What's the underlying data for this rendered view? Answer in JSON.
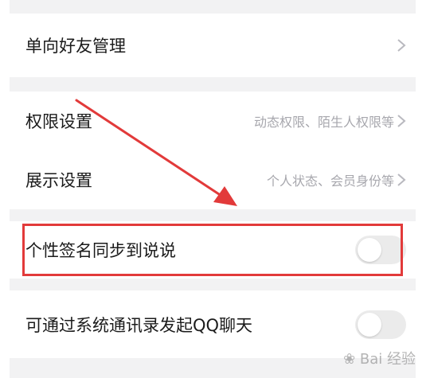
{
  "settings": {
    "one_way_friends": {
      "label": "单向好友管理"
    },
    "permissions": {
      "label": "权限设置",
      "value": "动态权限、陌生人权限等"
    },
    "display": {
      "label": "展示设置",
      "value": "个人状态、会员身份等"
    },
    "signature_sync": {
      "label": "个性签名同步到说说",
      "enabled": false
    },
    "contacts_chat": {
      "label": "可通过系统通讯录发起QQ聊天",
      "enabled": false
    }
  },
  "watermark": {
    "text": "Bai 经验",
    "icon": "paw-icon"
  },
  "colors": {
    "highlight": "#e23a3a",
    "toggle_off": "#ebebeb",
    "value_text": "#a7a7ad"
  }
}
